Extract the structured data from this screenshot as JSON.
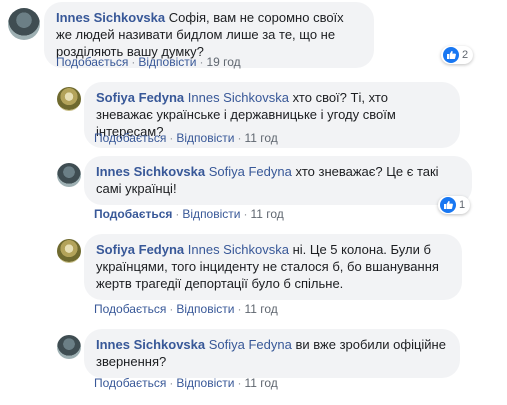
{
  "comments": [
    {
      "author": "Innes Sichkovska",
      "mention": "",
      "text": "Софія, вам не соромно своїх же людей називати бидлом лише за те, що не розділяють вашу думку?",
      "like_label": "Подобається",
      "reply_label": "Відповісти",
      "time": "19 год",
      "reactions": "2"
    },
    {
      "author": "Sofiya Fedyna",
      "mention": "Innes Sichkovska",
      "text": "хто свої? Ті, хто зневажає українське і державницьке і угоду своїм інтересам?",
      "like_label": "Подобається",
      "reply_label": "Відповісти",
      "time": "11 год"
    },
    {
      "author": "Innes Sichkovska",
      "mention": "Sofiya Fedyna",
      "text": "хто зневажає? Це є такі самі українці!",
      "like_label": "Подобається",
      "reply_label": "Відповісти",
      "time": "11 год",
      "reactions": "1"
    },
    {
      "author": "Sofiya Fedyna",
      "mention": "Innes Sichkovska",
      "text": "ні. Це 5 колона. Були б українцями, того інциденту не сталося б, бо вшанування жертв трагедії депортації було б спільне.",
      "like_label": "Подобається",
      "reply_label": "Відповісти",
      "time": "11 год"
    },
    {
      "author": "Innes Sichkovska",
      "mention": "Sofiya Fedyna",
      "text": "ви вже зробили офіційне звернення?",
      "like_label": "Подобається",
      "reply_label": "Відповісти",
      "time": "11 год"
    }
  ]
}
